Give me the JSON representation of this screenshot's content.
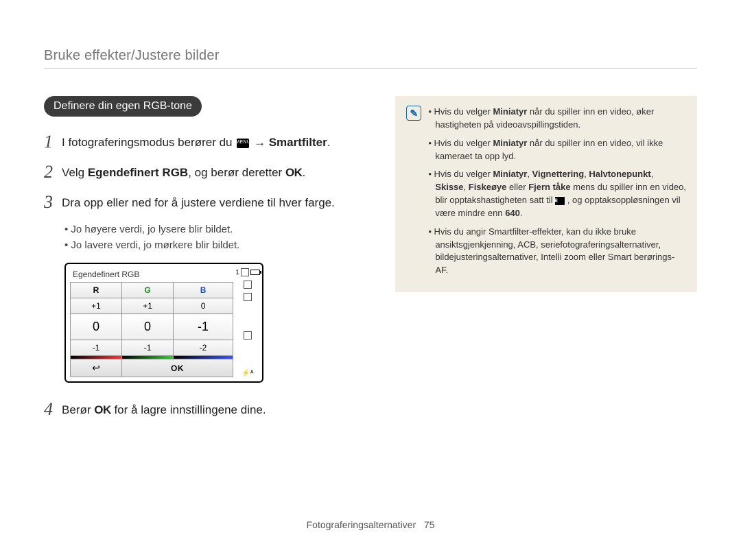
{
  "header": {
    "breadcrumb": "Bruke effekter/Justere bilder"
  },
  "section": {
    "title": "Deﬁnere din egen RGB-tone"
  },
  "steps": {
    "s1": {
      "num": "1",
      "before": "I fotograferingsmodus berører du ",
      "menu": "MENU",
      "arrow": " → ",
      "after_bold": "Smartﬁlter",
      "after_tail": "."
    },
    "s2": {
      "num": "2",
      "a": "Velg ",
      "b": "Egendeﬁnert RGB",
      "c": ", og berør deretter ",
      "ok": "OK",
      "d": "."
    },
    "s3": {
      "num": "3",
      "text": "Dra opp eller ned for å justere verdiene til hver farge.",
      "bullets": {
        "b1": "Jo høyere verdi, jo lysere blir bildet.",
        "b2": "Jo lavere verdi, jo mørkere blir bildet."
      }
    },
    "s4": {
      "num": "4",
      "a": "Berør ",
      "ok": "OK",
      "b": " for å lagre innstillingene dine."
    }
  },
  "rgb": {
    "title": "Egendeﬁnert RGB",
    "headers": {
      "r": "R",
      "g": "G",
      "b": "B"
    },
    "rows": {
      "above": {
        "r": "+1",
        "g": "+1",
        "b": "0"
      },
      "current": {
        "r": "0",
        "g": "0",
        "b": "-1"
      },
      "below": {
        "r": "-1",
        "g": "-1",
        "b": "-2"
      }
    },
    "buttons": {
      "back": "↩",
      "ok": "OK"
    },
    "side": {
      "count": "1",
      "flash": "⚡ᴬ"
    }
  },
  "note": {
    "n1a": "Hvis du velger ",
    "n1b": "Miniatyr",
    "n1c": " når du spiller inn en video, øker hastigheten på videoavspillingstiden.",
    "n2a": "Hvis du velger ",
    "n2b": "Miniatyr",
    "n2c": " når du spiller inn en video, vil ikke kameraet ta opp lyd.",
    "n3a": "Hvis du velger ",
    "n3b": "Miniatyr",
    "n3c": ", ",
    "n3d": "Vignettering",
    "n3e": ", ",
    "n3f": "Halvtonepunkt",
    "n3g": ", ",
    "n3h": "Skisse",
    "n3i": ", ",
    "n3j": "Fiskeøye",
    "n3k": " eller ",
    "n3l": "Fjern tåke",
    "n3m": " mens du spiller inn en video, blir opptakshastigheten satt til ",
    "n3rec": "⬛",
    "n3n": " , og opptaksoppløsningen vil være mindre enn ",
    "n3o": "640",
    "n3p": ".",
    "n4": "Hvis du angir Smartﬁlter-effekter, kan du ikke bruke ansiktsgjenkjenning, ACB, seriefotograferingsalternativer, bildejusteringsalternativer, Intelli zoom eller Smart berørings-AF."
  },
  "footer": {
    "section": "Fotograferingsalternativer",
    "page": "75"
  }
}
